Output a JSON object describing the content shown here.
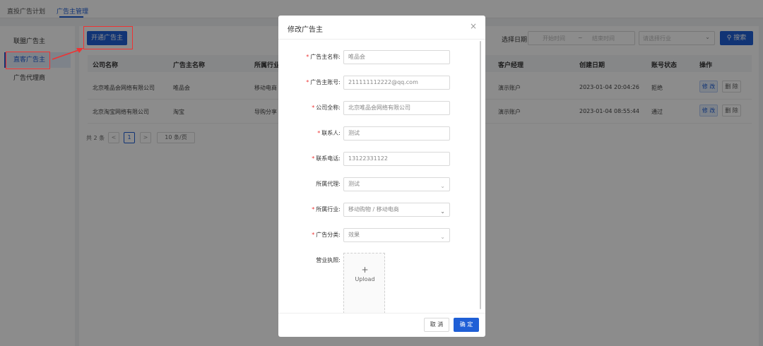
{
  "top_tabs": [
    {
      "label": "直投广告计划"
    },
    {
      "label": "广告主管理"
    }
  ],
  "sidebar": {
    "items": [
      {
        "label": "联盟广告主"
      },
      {
        "label": "直客广告主"
      },
      {
        "label": "广告代理商"
      }
    ]
  },
  "toolbar": {
    "open_label": "开通广告主",
    "date_label": "选择日期",
    "start_placeholder": "开始时间",
    "range_sep": "~",
    "end_placeholder": "结束时间",
    "industry_placeholder": "请选择行业",
    "search_label": "搜索"
  },
  "table": {
    "columns": [
      "公司名称",
      "广告主名称",
      "所属行业",
      "客户经理",
      "创建日期",
      "账号状态",
      "操作"
    ],
    "rows": [
      {
        "company": "北京唯品会网络有限公司",
        "name": "唯品会",
        "industry": "移动电商",
        "manager": "演示账户",
        "created": "2023-01-04 20:04:26",
        "status": "拒绝"
      },
      {
        "company": "北京淘宝网络有限公司",
        "name": "淘宝",
        "industry": "导购分享",
        "manager": "演示账户",
        "created": "2023-01-04 08:55:44",
        "status": "通过"
      }
    ],
    "edit_label": "修 改",
    "delete_label": "删 除"
  },
  "pagination": {
    "total_text": "共 2 条",
    "prev": "<",
    "current_page": "1",
    "next": ">",
    "page_size": "10 条/页"
  },
  "modal": {
    "title": "修改广告主",
    "close": "×",
    "fields": {
      "name": {
        "label": "广告主名称:",
        "value": "唯品会"
      },
      "account": {
        "label": "广告主账号:",
        "value": "211111112222@qq.com"
      },
      "company": {
        "label": "公司全称:",
        "value": "北京唯品会网络有限公司"
      },
      "contact": {
        "label": "联系人:",
        "value": "测试"
      },
      "phone": {
        "label": "联系电话:",
        "value": "13122331122"
      },
      "agent": {
        "label": "所属代理:",
        "value": "测试"
      },
      "industry": {
        "label": "所属行业:",
        "value": "移动购物 / 移动电商"
      },
      "category": {
        "label": "广告分类:",
        "value": "效果"
      },
      "license": {
        "label": "营业执照:"
      }
    },
    "upload_plus": "+",
    "upload_text": "Upload",
    "cancel_label": "取 消",
    "ok_label": "确 定"
  },
  "colors": {
    "primary": "#1f5fd6",
    "annotation": "#e33333"
  },
  "icons": [
    "search-icon",
    "close-icon",
    "chevron-down-icon",
    "plus-icon",
    "arrow-annotation-icon"
  ]
}
